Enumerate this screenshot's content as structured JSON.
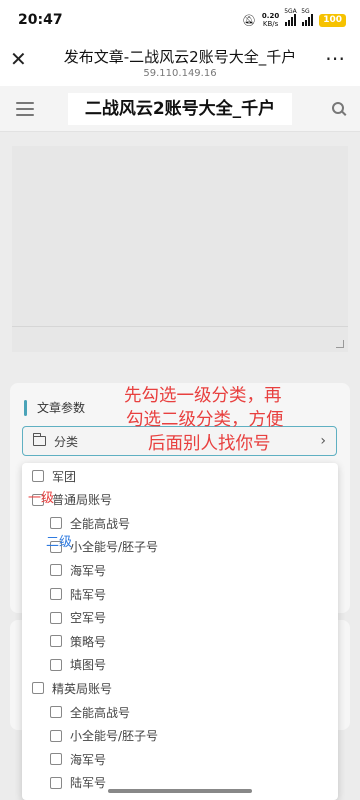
{
  "status_bar": {
    "time": "20:47",
    "net_speed_value": "0.20",
    "net_speed_unit": "KB/s",
    "sig1_tag": "5GA",
    "sig2_tag": "5G",
    "battery": "100",
    "battery_color": "#f6c200"
  },
  "title_bar": {
    "close_icon": "close-icon",
    "title": "发布文章-二战风云2账号大全_千户",
    "subtitle": "59.110.149.16",
    "more_icon": "more-icon"
  },
  "site_header": {
    "menu_icon": "hamburger-icon",
    "site_title": "二战风云2账号大全_千户",
    "search_icon": "search-icon"
  },
  "params": {
    "section_title": "文章参数",
    "category_label": "分类",
    "accent_color": "#4aa3b8"
  },
  "dropdown": {
    "options": [
      {
        "label": "军团",
        "level": 1
      },
      {
        "label": "普通局账号",
        "level": 1
      },
      {
        "label": "全能高战号",
        "level": 2
      },
      {
        "label": "小全能号/胚子号",
        "level": 2
      },
      {
        "label": "海军号",
        "level": 2
      },
      {
        "label": "陆军号",
        "level": 2
      },
      {
        "label": "空军号",
        "level": 2
      },
      {
        "label": "策略号",
        "level": 2
      },
      {
        "label": "填图号",
        "level": 2
      },
      {
        "label": "精英局账号",
        "level": 1
      },
      {
        "label": "全能高战号",
        "level": 2
      },
      {
        "label": "小全能号/胚子号",
        "level": 2
      },
      {
        "label": "海军号",
        "level": 2
      },
      {
        "label": "陆军号",
        "level": 2
      }
    ]
  },
  "annotations": {
    "main_lines": [
      "先勾选一级分类，再",
      "勾选二级分类，方便",
      "后面别人找你号"
    ],
    "level1": "一级",
    "level2": "二级",
    "main_color": "#e8403f",
    "level2_color": "#2f7be0"
  }
}
